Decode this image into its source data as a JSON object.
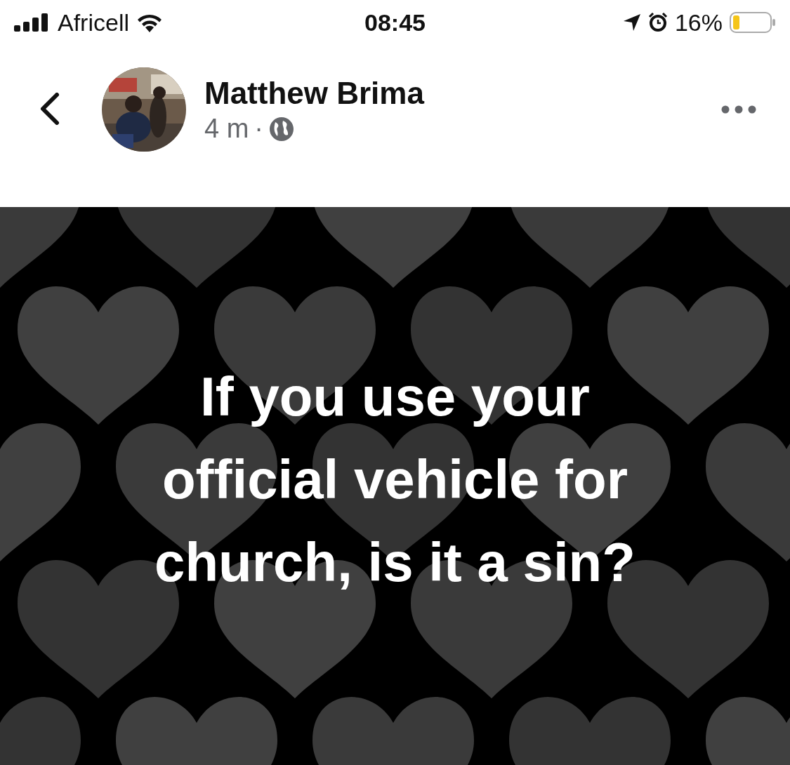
{
  "status_bar": {
    "carrier": "Africell",
    "time": "08:45",
    "battery": "16%"
  },
  "post": {
    "author": "Matthew Brima",
    "age": "4 m",
    "separator": "·",
    "text": "If you use your\nofficial vehicle for\nchurch, is it a sin?"
  }
}
